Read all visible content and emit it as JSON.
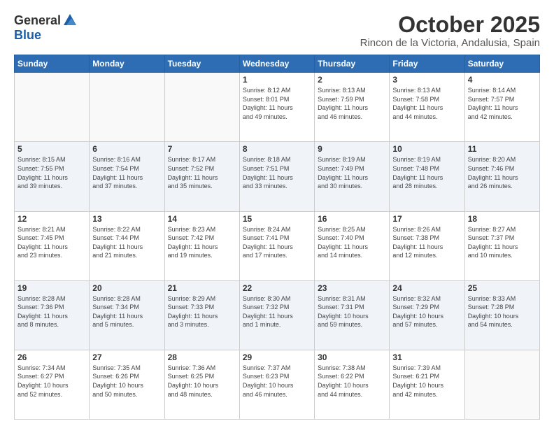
{
  "header": {
    "logo_general": "General",
    "logo_blue": "Blue",
    "month_title": "October 2025",
    "subtitle": "Rincon de la Victoria, Andalusia, Spain"
  },
  "weekdays": [
    "Sunday",
    "Monday",
    "Tuesday",
    "Wednesday",
    "Thursday",
    "Friday",
    "Saturday"
  ],
  "weeks": [
    [
      {
        "day": "",
        "info": ""
      },
      {
        "day": "",
        "info": ""
      },
      {
        "day": "",
        "info": ""
      },
      {
        "day": "1",
        "info": "Sunrise: 8:12 AM\nSunset: 8:01 PM\nDaylight: 11 hours\nand 49 minutes."
      },
      {
        "day": "2",
        "info": "Sunrise: 8:13 AM\nSunset: 7:59 PM\nDaylight: 11 hours\nand 46 minutes."
      },
      {
        "day": "3",
        "info": "Sunrise: 8:13 AM\nSunset: 7:58 PM\nDaylight: 11 hours\nand 44 minutes."
      },
      {
        "day": "4",
        "info": "Sunrise: 8:14 AM\nSunset: 7:57 PM\nDaylight: 11 hours\nand 42 minutes."
      }
    ],
    [
      {
        "day": "5",
        "info": "Sunrise: 8:15 AM\nSunset: 7:55 PM\nDaylight: 11 hours\nand 39 minutes."
      },
      {
        "day": "6",
        "info": "Sunrise: 8:16 AM\nSunset: 7:54 PM\nDaylight: 11 hours\nand 37 minutes."
      },
      {
        "day": "7",
        "info": "Sunrise: 8:17 AM\nSunset: 7:52 PM\nDaylight: 11 hours\nand 35 minutes."
      },
      {
        "day": "8",
        "info": "Sunrise: 8:18 AM\nSunset: 7:51 PM\nDaylight: 11 hours\nand 33 minutes."
      },
      {
        "day": "9",
        "info": "Sunrise: 8:19 AM\nSunset: 7:49 PM\nDaylight: 11 hours\nand 30 minutes."
      },
      {
        "day": "10",
        "info": "Sunrise: 8:19 AM\nSunset: 7:48 PM\nDaylight: 11 hours\nand 28 minutes."
      },
      {
        "day": "11",
        "info": "Sunrise: 8:20 AM\nSunset: 7:46 PM\nDaylight: 11 hours\nand 26 minutes."
      }
    ],
    [
      {
        "day": "12",
        "info": "Sunrise: 8:21 AM\nSunset: 7:45 PM\nDaylight: 11 hours\nand 23 minutes."
      },
      {
        "day": "13",
        "info": "Sunrise: 8:22 AM\nSunset: 7:44 PM\nDaylight: 11 hours\nand 21 minutes."
      },
      {
        "day": "14",
        "info": "Sunrise: 8:23 AM\nSunset: 7:42 PM\nDaylight: 11 hours\nand 19 minutes."
      },
      {
        "day": "15",
        "info": "Sunrise: 8:24 AM\nSunset: 7:41 PM\nDaylight: 11 hours\nand 17 minutes."
      },
      {
        "day": "16",
        "info": "Sunrise: 8:25 AM\nSunset: 7:40 PM\nDaylight: 11 hours\nand 14 minutes."
      },
      {
        "day": "17",
        "info": "Sunrise: 8:26 AM\nSunset: 7:38 PM\nDaylight: 11 hours\nand 12 minutes."
      },
      {
        "day": "18",
        "info": "Sunrise: 8:27 AM\nSunset: 7:37 PM\nDaylight: 11 hours\nand 10 minutes."
      }
    ],
    [
      {
        "day": "19",
        "info": "Sunrise: 8:28 AM\nSunset: 7:36 PM\nDaylight: 11 hours\nand 8 minutes."
      },
      {
        "day": "20",
        "info": "Sunrise: 8:28 AM\nSunset: 7:34 PM\nDaylight: 11 hours\nand 5 minutes."
      },
      {
        "day": "21",
        "info": "Sunrise: 8:29 AM\nSunset: 7:33 PM\nDaylight: 11 hours\nand 3 minutes."
      },
      {
        "day": "22",
        "info": "Sunrise: 8:30 AM\nSunset: 7:32 PM\nDaylight: 11 hours\nand 1 minute."
      },
      {
        "day": "23",
        "info": "Sunrise: 8:31 AM\nSunset: 7:31 PM\nDaylight: 10 hours\nand 59 minutes."
      },
      {
        "day": "24",
        "info": "Sunrise: 8:32 AM\nSunset: 7:29 PM\nDaylight: 10 hours\nand 57 minutes."
      },
      {
        "day": "25",
        "info": "Sunrise: 8:33 AM\nSunset: 7:28 PM\nDaylight: 10 hours\nand 54 minutes."
      }
    ],
    [
      {
        "day": "26",
        "info": "Sunrise: 7:34 AM\nSunset: 6:27 PM\nDaylight: 10 hours\nand 52 minutes."
      },
      {
        "day": "27",
        "info": "Sunrise: 7:35 AM\nSunset: 6:26 PM\nDaylight: 10 hours\nand 50 minutes."
      },
      {
        "day": "28",
        "info": "Sunrise: 7:36 AM\nSunset: 6:25 PM\nDaylight: 10 hours\nand 48 minutes."
      },
      {
        "day": "29",
        "info": "Sunrise: 7:37 AM\nSunset: 6:23 PM\nDaylight: 10 hours\nand 46 minutes."
      },
      {
        "day": "30",
        "info": "Sunrise: 7:38 AM\nSunset: 6:22 PM\nDaylight: 10 hours\nand 44 minutes."
      },
      {
        "day": "31",
        "info": "Sunrise: 7:39 AM\nSunset: 6:21 PM\nDaylight: 10 hours\nand 42 minutes."
      },
      {
        "day": "",
        "info": ""
      }
    ]
  ]
}
